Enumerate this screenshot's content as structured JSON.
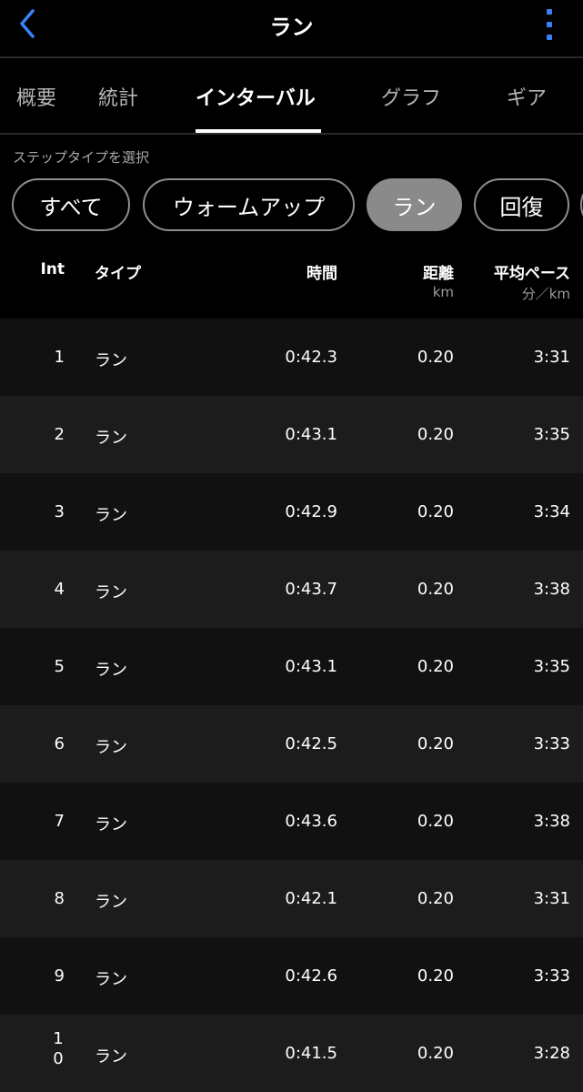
{
  "header": {
    "title": "ラン"
  },
  "tabs": [
    {
      "label": "概要"
    },
    {
      "label": "統計"
    },
    {
      "label": "インターバル"
    },
    {
      "label": "グラフ"
    },
    {
      "label": "ギア"
    }
  ],
  "step_type": {
    "label": "ステップタイプを選択",
    "chips": [
      {
        "label": "すべて"
      },
      {
        "label": "ウォームアップ"
      },
      {
        "label": "ラン"
      },
      {
        "label": "回復"
      }
    ]
  },
  "table": {
    "columns": {
      "int": "Int",
      "type": "タイプ",
      "time": "時間",
      "distance": "距離",
      "distance_unit": "km",
      "pace": "平均ペース",
      "pace_unit": "分／km"
    },
    "rows": [
      {
        "int": "1",
        "type": "ラン",
        "time": "0:42.3",
        "distance": "0.20",
        "pace": "3:31"
      },
      {
        "int": "2",
        "type": "ラン",
        "time": "0:43.1",
        "distance": "0.20",
        "pace": "3:35"
      },
      {
        "int": "3",
        "type": "ラン",
        "time": "0:42.9",
        "distance": "0.20",
        "pace": "3:34"
      },
      {
        "int": "4",
        "type": "ラン",
        "time": "0:43.7",
        "distance": "0.20",
        "pace": "3:38"
      },
      {
        "int": "5",
        "type": "ラン",
        "time": "0:43.1",
        "distance": "0.20",
        "pace": "3:35"
      },
      {
        "int": "6",
        "type": "ラン",
        "time": "0:42.5",
        "distance": "0.20",
        "pace": "3:33"
      },
      {
        "int": "7",
        "type": "ラン",
        "time": "0:43.6",
        "distance": "0.20",
        "pace": "3:38"
      },
      {
        "int": "8",
        "type": "ラン",
        "time": "0:42.1",
        "distance": "0.20",
        "pace": "3:31"
      },
      {
        "int": "9",
        "type": "ラン",
        "time": "0:42.6",
        "distance": "0.20",
        "pace": "3:33"
      },
      {
        "int": "10",
        "type": "ラン",
        "time": "0:41.5",
        "distance": "0.20",
        "pace": "3:28"
      }
    ]
  },
  "colors": {
    "background": "#000000",
    "accent": "#3b82f6",
    "chip_selected": "#8a8a8a",
    "row_odd": "#111111",
    "row_even": "#1c1c1c"
  }
}
